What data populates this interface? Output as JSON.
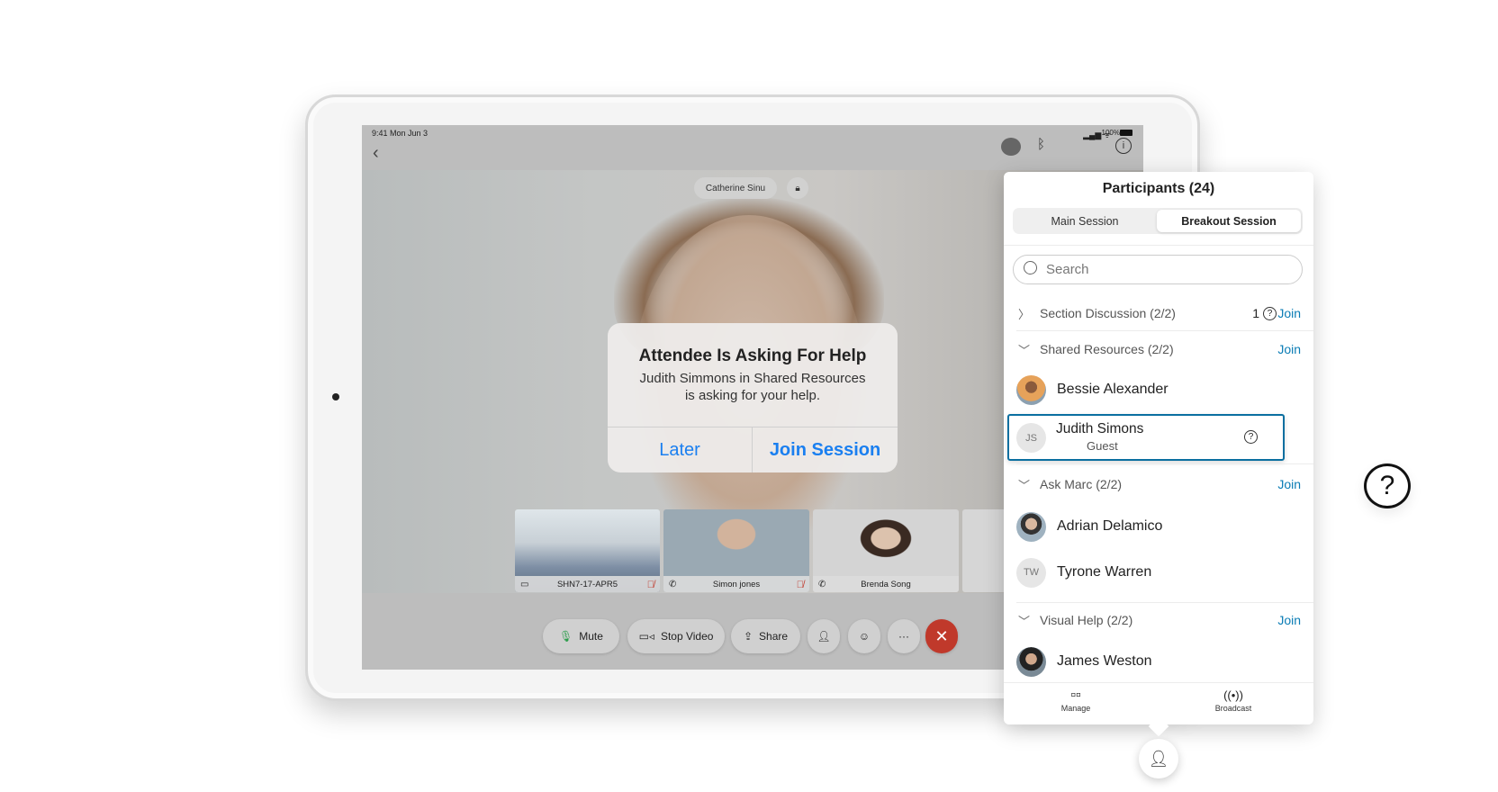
{
  "status_bar": {
    "time": "9:41  Mon Jun 3",
    "battery": "100%"
  },
  "meeting": {
    "active_speaker": "Catherine Sinu"
  },
  "dialog": {
    "title": "Attendee Is Asking For Help",
    "message_line1": "Judith Simmons in Shared Resources",
    "message_line2": "is asking for your help.",
    "later": "Later",
    "join": "Join Session"
  },
  "thumbnails": [
    {
      "name": "SHN7-17-APR5",
      "type": "room",
      "muted": true
    },
    {
      "name": "Simon jones",
      "type": "phone",
      "muted": true
    },
    {
      "name": "Brenda Song",
      "type": "phone",
      "muted": false
    }
  ],
  "controls": {
    "mute": "Mute",
    "stop_video": "Stop Video",
    "share": "Share"
  },
  "panel": {
    "title": "Participants (24)",
    "tabs": [
      "Main Session",
      "Breakout Session"
    ],
    "active_tab": "Breakout Session",
    "search_placeholder": "Search",
    "groups": [
      {
        "name": "Section Discussion (2/2)",
        "expanded": false,
        "help_count": "1",
        "join": "Join"
      },
      {
        "name": "Shared Resources (2/2)",
        "expanded": true,
        "join": "Join"
      },
      {
        "name": "Ask Marc (2/2)",
        "expanded": true,
        "join": "Join"
      },
      {
        "name": "Visual Help (2/2)",
        "expanded": true,
        "join": "Join"
      }
    ],
    "participants": [
      {
        "name": "Bessie Alexander"
      },
      {
        "name": "Judith Simons",
        "initials": "JS",
        "role": "Guest",
        "asking_help": true
      },
      {
        "name": "Adrian Delamico"
      },
      {
        "name": "Tyrone Warren",
        "initials": "TW"
      },
      {
        "name": "James Weston"
      }
    ],
    "footer": {
      "manage": "Manage",
      "broadcast": "Broadcast"
    }
  },
  "colors": {
    "accent": "#0a7cb5",
    "ios_blue": "#1a7ff0",
    "end_call": "#c0392b",
    "highlight_border": "#0a6fa0"
  }
}
